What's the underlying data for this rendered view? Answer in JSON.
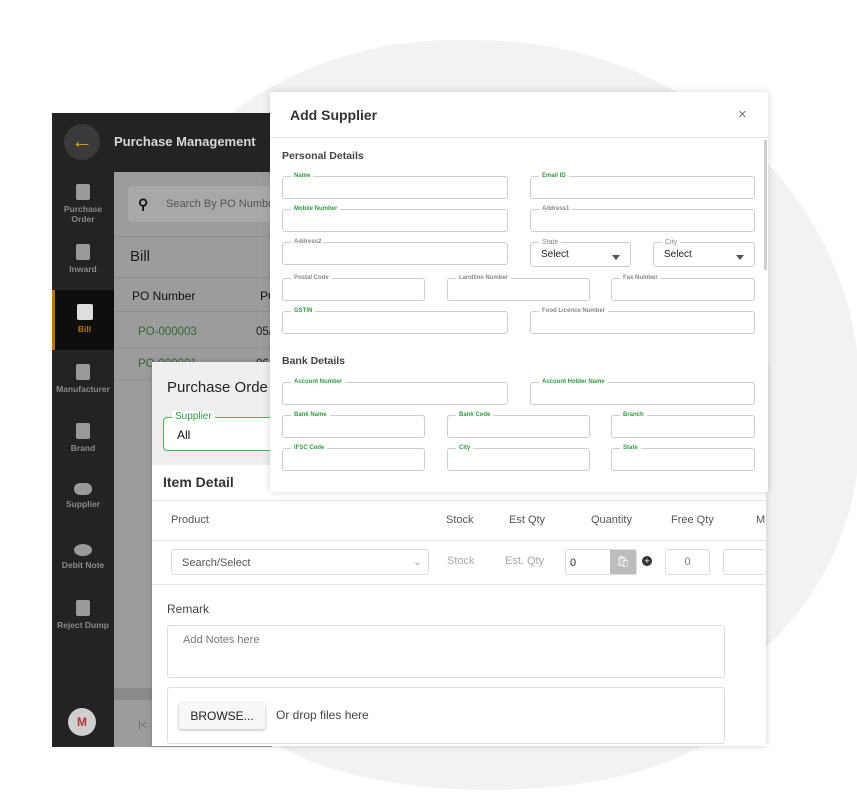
{
  "app": {
    "title": "Purchase Management",
    "search_placeholder": "Search By PO Number",
    "page_title": "Bill",
    "col_po": "PO Number",
    "col_po2": "PO",
    "rows": [
      {
        "po": "PO-000003",
        "date": "05/"
      },
      {
        "po": "PO-000001",
        "date": "06"
      }
    ],
    "avatar": "M"
  },
  "sidebar": {
    "items": [
      {
        "label": "Purchase Order",
        "icon": "clipboard-icon"
      },
      {
        "label": "Inward",
        "icon": "checklist-icon"
      },
      {
        "label": "Bill",
        "icon": "bill-icon",
        "active": true
      },
      {
        "label": "Manufacturer",
        "icon": "chip-icon"
      },
      {
        "label": "Brand",
        "icon": "brand-icon"
      },
      {
        "label": "Supplier",
        "icon": "handshake-icon"
      },
      {
        "label": "Debit Note",
        "icon": "coin-icon"
      },
      {
        "label": "Reject Dump",
        "icon": "trash-icon"
      }
    ]
  },
  "po": {
    "title": "Purchase Orde",
    "supplier_label": "Supplier",
    "supplier_value": "All",
    "item_detail": "Item Detail",
    "headers": [
      "Product",
      "Stock",
      "Est Qty",
      "Quantity",
      "Free Qty",
      "M"
    ],
    "product_placeholder": "Search/Select",
    "stock": "Stock",
    "est_qty": "Est. Qty",
    "quantity": "0",
    "free_qty": "0",
    "remark": "Remark",
    "notes_placeholder": "Add Notes here",
    "browse": "BROWSE...",
    "drop": "Or drop files here",
    "first_page": "|<"
  },
  "modal": {
    "title": "Add Supplier",
    "close": "×",
    "personal": "Personal Details",
    "bank": "Bank Details",
    "f": {
      "name": "Name",
      "email": "Email ID",
      "mobile": "Mobile Number",
      "address1": "Address1",
      "address2": "Address2",
      "state": "State",
      "city": "City",
      "select": "Select",
      "postal": "Postal Code",
      "landline": "Landline Number",
      "fax": "Fax Number",
      "gstin": "GSTIN",
      "food": "Food Licence Number",
      "acc_no": "Account Number",
      "acc_name": "Account Holder Name",
      "bank_name": "Bank Name",
      "bank_code": "Bank Code",
      "branch": "Branch",
      "ifsc": "IFSC Code",
      "bcity": "City",
      "bstate": "State"
    }
  },
  "colors": {
    "accent": "#2e9d3f",
    "sidebar_active": "#b8720a",
    "sidebar_bg": "#232323"
  }
}
